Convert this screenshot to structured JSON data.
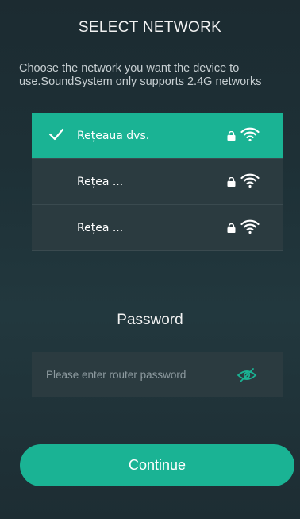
{
  "header": {
    "title": "SELECT NETWORK"
  },
  "description": "Choose the network you want the device to use.SoundSystem only supports 2.4G networks",
  "networks": [
    {
      "name": "Rețeaua dvs.",
      "selected": true
    },
    {
      "name": "Rețea ...",
      "selected": false
    },
    {
      "name": "Rețea ...",
      "selected": false
    }
  ],
  "password": {
    "label": "Password",
    "placeholder": "Please enter router password",
    "value": ""
  },
  "continue_label": "Continue",
  "colors": {
    "accent": "#1ab394",
    "row_bg": "#2b3b40",
    "background": "#1e3137"
  },
  "icons": {
    "selected": "check-icon",
    "secured": "lock-icon",
    "signal": "wifi-icon",
    "visibility": "eye-off-icon"
  }
}
